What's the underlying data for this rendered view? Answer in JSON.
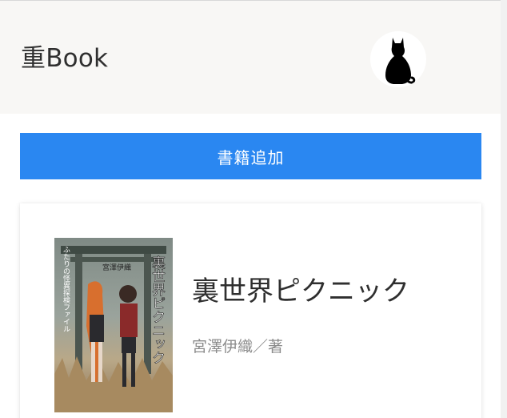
{
  "header": {
    "app_title": "重Book",
    "avatar_icon": "cat-silhouette-icon"
  },
  "actions": {
    "add_book_label": "書籍追加"
  },
  "books": [
    {
      "title": "裏世界ピクニック",
      "author": "宮澤伊織／著",
      "cover": {
        "title_text": "裏世界ピクニック",
        "subtitle_text": "ふたりの怪異探検ファイル",
        "author_text": "宮澤伊織"
      }
    }
  ],
  "colors": {
    "header_bg": "#f8f7f5",
    "accent": "#2a87f1",
    "title_text": "#2f2f2f",
    "author_text": "#8b8b8b"
  }
}
